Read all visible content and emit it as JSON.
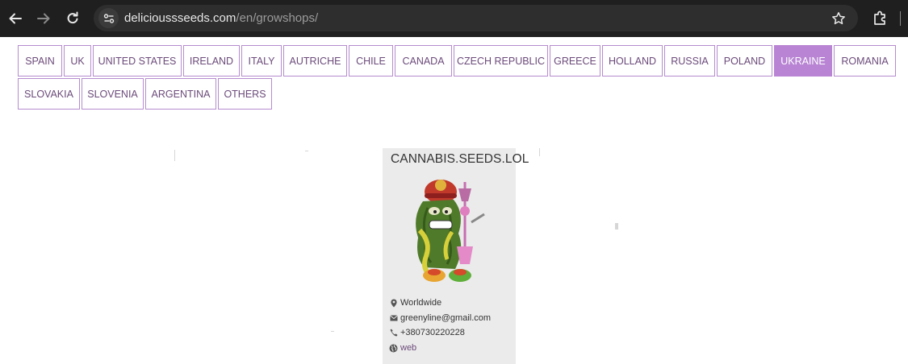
{
  "browser": {
    "url_domain": "delicioussseeds.com",
    "url_path": "/en/growshops/"
  },
  "tabs": {
    "row1": [
      "SPAIN",
      "UK",
      "UNITED STATES",
      "IRELAND",
      "ITALY",
      "AUTRICHE",
      "CHILE",
      "CANADA",
      "CZECH REPUBLIC",
      "GREECE",
      "HOLLAND",
      "RUSSIA",
      "POLAND",
      "UKRAINE",
      "ROMANIA"
    ],
    "row2": [
      "SLOVAKIA",
      "SLOVENIA",
      "ARGENTINA",
      "OTHERS"
    ],
    "active": "UKRAINE"
  },
  "listing": {
    "name": "CANNABIS.SEEDS.LOL",
    "location": "Worldwide",
    "email": "greenyline@gmail.com",
    "phone": "+380730220228",
    "web_label": "web"
  },
  "icons": [
    "back-arrow-icon",
    "forward-arrow-icon",
    "reload-icon",
    "site-info-icon",
    "bookmark-star-icon",
    "extensions-icon",
    "map-pin-icon",
    "envelope-icon",
    "phone-icon",
    "globe-icon"
  ],
  "colors": {
    "accent": "#b884d3",
    "tab_border": "#b58ccf",
    "tab_text": "#6b4a7a",
    "card_bg": "#ebebeb"
  }
}
